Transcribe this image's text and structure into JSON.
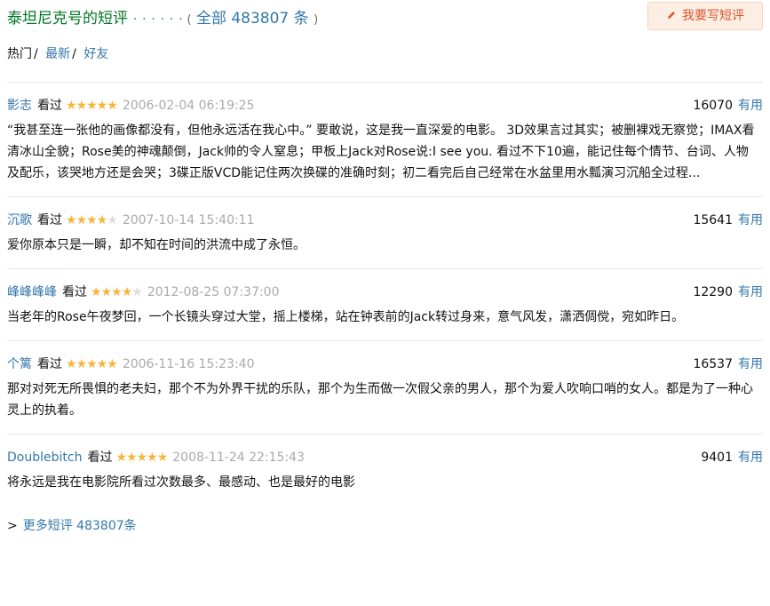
{
  "header": {
    "title": "泰坦尼克号的短评",
    "dots": "· · · · · ·",
    "paren_open": "(",
    "all_label": "全部 483807 条",
    "paren_close": ")",
    "write_button": "我要写短评",
    "write_icon": "pencil-icon"
  },
  "tabs": {
    "hot": "热门",
    "sep1": "/",
    "latest": "最新",
    "sep2": "/",
    "friends": "好友"
  },
  "colors": {
    "title_green": "#007722",
    "link_blue": "#3377aa",
    "star_gold": "#f6b63b",
    "button_text": "#d9552c",
    "button_bg": "#fdeee3"
  },
  "comments": [
    {
      "user": "影志",
      "status": "看过",
      "rating": 5,
      "time": "2006-02-04 06:19:25",
      "votes": "16070",
      "useful": "有用",
      "text": "“我甚至连一张他的画像都没有，但他永远活在我心中。” 要敢说，这是我一直深爱的电影。 3D效果言过其实；被删裸戏无察觉；IMAX看清冰山全貌；Rose美的神魂颠倒，Jack帅的令人窒息；甲板上Jack对Rose说:I see you. 看过不下10遍，能记住每个情节、台词、人物及配乐，该哭地方还是会哭；3碟正版VCD能记住两次换碟的准确时刻；初二看完后自己经常在水盆里用水瓢演习沉船全过程..."
    },
    {
      "user": "沉歌",
      "status": "看过",
      "rating": 4,
      "time": "2007-10-14 15:40:11",
      "votes": "15641",
      "useful": "有用",
      "text": "爱你原本只是一瞬，却不知在时间的洪流中成了永恒。"
    },
    {
      "user": "峰峰峰峰",
      "status": "看过",
      "rating": 4,
      "time": "2012-08-25 07:37:00",
      "votes": "12290",
      "useful": "有用",
      "text": "当老年的Rose午夜梦回，一个长镜头穿过大堂，摇上楼梯，站在钟表前的Jack转过身来，意气风发，潇洒倜傥，宛如昨日。"
    },
    {
      "user": "个篱",
      "status": "看过",
      "rating": 5,
      "time": "2006-11-16 15:23:40",
      "votes": "16537",
      "useful": "有用",
      "text": "那对对死无所畏惧的老夫妇，那个不为外界干扰的乐队，那个为生而做一次假父亲的男人，那个为爱人吹响口哨的女人。都是为了一种心灵上的执着。"
    },
    {
      "user": "Doublebitch",
      "status": "看过",
      "rating": 5,
      "time": "2008-11-24 22:15:43",
      "votes": "9401",
      "useful": "有用",
      "text": "将永远是我在电影院所看过次数最多、最感动、也是最好的电影"
    }
  ],
  "more": {
    "prefix": ">",
    "label": "更多短评 483807条"
  }
}
